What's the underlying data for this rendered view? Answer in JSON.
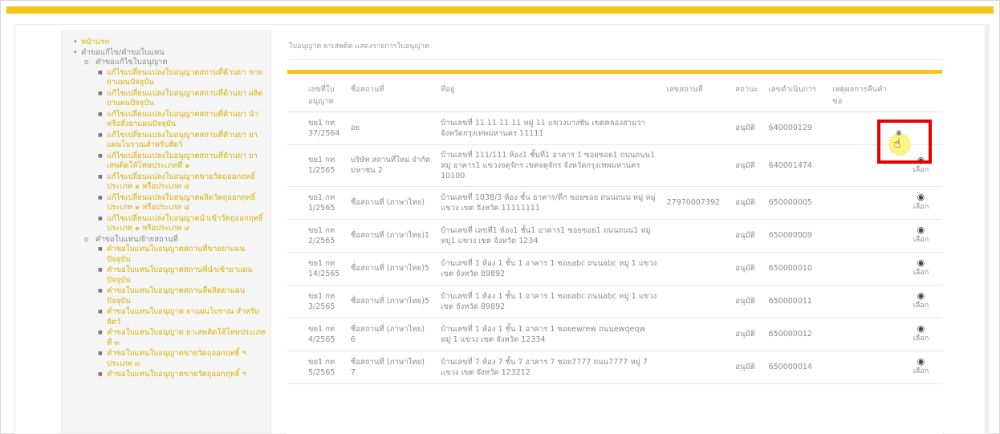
{
  "breadcrumb": "ใบอนุญาต ยาเสพติด แสดงรายการใบอนุญาต",
  "sidebar": {
    "home": "หน้าแรก",
    "requests": "คำขอแก้ไข/คำขอใบแทน",
    "sec_edit": "คำขอแก้ไขใบอนุญาต",
    "edit_items": [
      "แก้ไขเปลี่ยนแปลงใบอนุญาตสถานที่ด้านยา ขายยาแผนปัจจุบัน",
      "แก้ไขเปลี่ยนแปลงใบอนุญาตสถานที่ด้านยา ผลิตยาแผนปัจจุบัน",
      "แก้ไขเปลี่ยนแปลงใบอนุญาตสถานที่ด้านยา นำหรือสั่งยาแผนปัจจุบัน",
      "แก้ไขเปลี่ยนแปลงใบอนุญาตสถานที่ด้านยา ยาแผนโบราณสำหรับสัตว์",
      "แก้ไขเปลี่ยนแปลงใบอนุญาตสถานที่ด้านยา ยาเสพติดให้โทษประเภทที่ ๑",
      "แก้ไขเปลี่ยนแปลงใบอนุญาตขายวัตถุออกฤทธิ์ ประเภท ๑ หรือประเภท ๔",
      "แก้ไขเปลี่ยนแปลงใบอนุญาตผลิตวัตถุออกฤทธิ์ ประเภท ๑ หรือประเภท ๔",
      "แก้ไขเปลี่ยนแปลงใบอนุญาตนำเข้าวัตถุออกฤทธิ์ ประเภท ๑ หรือประเภท ๔"
    ],
    "sec_replace": "คำขอใบแทน/ย้ายสถานที่",
    "replace_items": [
      "คำขอใบแทนใบอนุญาตสถานที่ขายยาแผนปัจจุบัน",
      "คำขอใบแทนใบอนุญาตสถานที่นำเข้ายาแผนปัจจุบัน",
      "คำขอใบแทนใบอนุญาตสถานที่ผลิตยาแผนปัจจุบัน",
      "คำขอใบแทนใบอนุญาต ยาแผนโบราณ สำหรับสัตว์",
      "คำขอใบแทนใบอนุญาต ยาเสพติดให้โทษประเภทที่ ๓",
      "คำขอใบแทนใบอนุญาตขายวัตถุออกฤทธิ์ ฯ ประเภท ๓",
      "คำขอใบแทนใบอนุญาตขายวัตถุออกฤทธิ์ ฯ"
    ]
  },
  "table": {
    "headers": [
      "เลขที่ใบอนุญาต",
      "ชื่อสถานที่",
      "ที่อยู่",
      "เลขสถานที่",
      "สถานะ",
      "เลขดำเนินการ",
      "เหตุผลการคืนคำขอ",
      ""
    ],
    "select_label": "เลือก",
    "rows": [
      {
        "no": "ขย1 กท 37/2564",
        "name": "อย",
        "addr": "บ้านเลขที่ 11 11 11 11 หมู่ 11 แขวงบางชัน เขตคลองสามวา จังหวัดกรุงเทพมหานคร 11111",
        "phone": "",
        "status": "อนุมัติ",
        "op": "640000129",
        "reason": ""
      },
      {
        "no": "ขย1 กท 1/2565",
        "name": "บริษัท สถานที่ใหม่ จำกัด มหาชน 2",
        "addr": "บ้านเลขที่ 111/111 ห้อง1 ชั้นที่1 อาคาร 1 ซอยซอย1 ถนนถนน1 หมู่ อาคาร1 แขวงจตุจักร เขตจตุจักร จังหวัดกรุงเทพมหานคร 10100",
        "phone": "",
        "status": "อนุมัติ",
        "op": "640001474",
        "reason": ""
      },
      {
        "no": "ขย1 กท 1/2565",
        "name": "ชื่อสถานที่ (ภาษาไทย)",
        "addr": "บ้านเลขที่ 1038/3 ห้อง ชั้น อาคาร/ตึก ซอยซอย ถนนถนน หมู่ หมู่ แขวง เขต จังหวัด 11111111",
        "phone": "27970007392",
        "status": "อนุมัติ",
        "op": "650000005",
        "reason": ""
      },
      {
        "no": "ขย1 กท 2/2565",
        "name": "ชื่อสถานที่ (ภาษาไทย)1",
        "addr": "บ้านเลขที่ เลขที่1 ห้อง1 ชั้น1 อาคาร1 ซอยซอย1 ถนนถนน1 หมู่ หมู่1 แขวง เขต จังหวัด 1234",
        "phone": "",
        "status": "อนุมัติ",
        "op": "650000009",
        "reason": ""
      },
      {
        "no": "ขย1 กท 14/2565",
        "name": "ชื่อสถานที่ (ภาษาไทย)5",
        "addr": "บ้านเลขที่ 1 ห้อง 1 ชั้น 1 อาคาร 1 ซอยabc ถนนabc หมู่ 1 แขวง เขต จังหวัด 89892",
        "phone": "",
        "status": "อนุมัติ",
        "op": "650000010",
        "reason": ""
      },
      {
        "no": "ขย1 กท 3/2565",
        "name": "ชื่อสถานที่ (ภาษาไทย)5",
        "addr": "บ้านเลขที่ 1 ห้อง 1 ชั้น 1 อาคาร 1 ซอยabc ถนนabc หมู่ 1 แขวง เขต จังหวัด 89892",
        "phone": "",
        "status": "อนุมัติ",
        "op": "650000011",
        "reason": ""
      },
      {
        "no": "ขย1 กท 4/2565",
        "name": "ชื่อสถานที่ (ภาษาไทย) 6",
        "addr": "บ้านเลขที่ 1 ห้อง 1 ชั้น 1 อาคาร 1 ซอยewrew ถนนewqeqw หมู่ 1 แขวง เขต จังหวัด 12334",
        "phone": "",
        "status": "อนุมัติ",
        "op": "650000012",
        "reason": ""
      },
      {
        "no": "ขย1 กท 5/2565",
        "name": "ชื่อสถานที่ (ภาษาไทย) 7",
        "addr": "บ้านเลขที่ 7 ห้อง 7 ชั้น 7 อาคาร 7 ซอย7777 ถนน7777 หมู่ 7 แขวง เขต จังหวัด 123212",
        "phone": "",
        "status": "อนุมัติ",
        "op": "650000014",
        "reason": ""
      }
    ]
  },
  "colors": {
    "accent": "#f3c51c",
    "highlight": "#e60000",
    "link": "#d4b200"
  },
  "icons": {
    "select": "eye-icon",
    "cursor": "hand-pointer-icon"
  }
}
